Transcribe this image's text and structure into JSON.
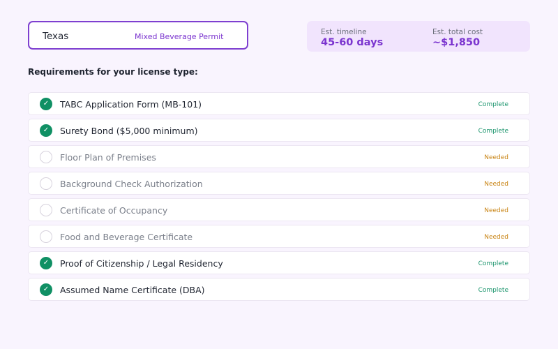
{
  "selector": {
    "state": "Texas",
    "license_type": "Mixed Beverage Permit"
  },
  "estimate": {
    "timeline_label": "Est. timeline",
    "timeline_value": "45-60 days",
    "cost_label": "Est. total cost",
    "cost_value": "~$1,850"
  },
  "requirements": {
    "heading": "Requirements for your license type:",
    "items": [
      {
        "label": "TABC Application Form (MB-101)",
        "status": "Complete",
        "done": true
      },
      {
        "label": "Surety Bond ($5,000 minimum)",
        "status": "Complete",
        "done": true
      },
      {
        "label": "Floor Plan of Premises",
        "status": "Needed",
        "done": false
      },
      {
        "label": "Background Check Authorization",
        "status": "Needed",
        "done": false
      },
      {
        "label": "Certificate of Occupancy",
        "status": "Needed",
        "done": false
      },
      {
        "label": "Food and Beverage Certificate",
        "status": "Needed",
        "done": false
      },
      {
        "label": "Proof of Citizenship / Legal Residency",
        "status": "Complete",
        "done": true
      },
      {
        "label": "Assumed Name Certificate (DBA)",
        "status": "Complete",
        "done": true
      }
    ]
  },
  "icons": {
    "complete": "check-circle-icon",
    "needed": "empty-circle-icon"
  },
  "colors": {
    "accent": "#7b35cf",
    "complete": "#109064",
    "needed": "#c98414"
  }
}
